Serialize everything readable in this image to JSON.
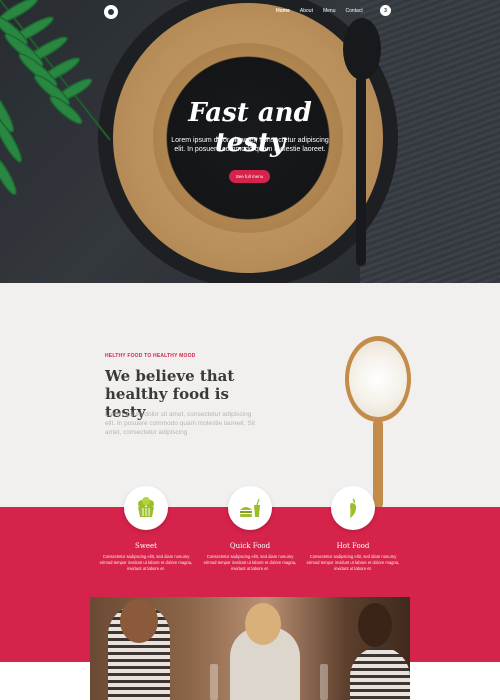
{
  "nav": {
    "items": [
      {
        "label": "Home",
        "active": true
      },
      {
        "label": "About",
        "active": false
      },
      {
        "label": "Menu",
        "active": false
      },
      {
        "label": "Contact",
        "active": false
      }
    ],
    "badge": "3"
  },
  "hero": {
    "title": "Fast and testy",
    "subtitle": "Lorem ipsum dolor sit amet, consectetur adipiscing elit. In posuere commodo quam molestie laoreet.",
    "button_label": "See full menu"
  },
  "about": {
    "eyebrow": "HELTHY FOOD TO HEALTHY MOOD",
    "heading": "We believe that healthy food is testy",
    "paragraph": "Lorem ipsum dolor sit amet, consectetur adipiscing elit. In posuere commodo quam molestie laoreet. Sit amet, consectetur adipiscing"
  },
  "features": [
    {
      "icon": "cupcake-icon",
      "title": "Sweet",
      "desc": "Consectetur sadipscing elitr, sed diam nonumy eirmod tempor invidunt ut labore et dolore magna, invidunt ut labore et."
    },
    {
      "icon": "burger-drink-icon",
      "title": "Quick Food",
      "desc": "Consectetur sadipscing elitr, sed diam nonumy eirmod tempor invidunt ut labore et dolore magna, invidunt ut labore et."
    },
    {
      "icon": "chili-pepper-icon",
      "title": "Hot Food",
      "desc": "Consectetur sadipscing elitr, sed diam nonumy eirmod tempor invidunt ut labore et dolore magna, invidunt ut labore et."
    }
  ],
  "colors": {
    "accent": "#d6234b",
    "hero_dark": "#2e3338",
    "about_bg": "#f1f0ee",
    "heading_text": "#3a3a3a",
    "muted_text": "#b5b5b5"
  }
}
